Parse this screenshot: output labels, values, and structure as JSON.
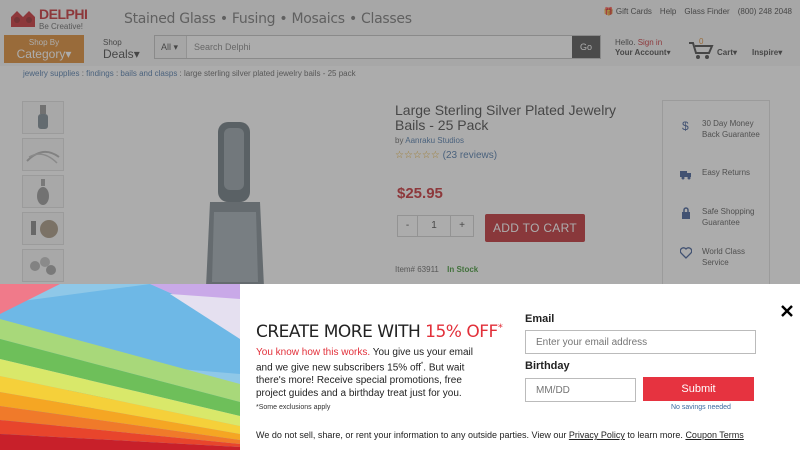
{
  "header": {
    "logo_name": "DELPHI",
    "logo_tagline": "Be Creative!",
    "site_tagline": "Stained Glass • Fusing • Mosaics • Classes",
    "top_links": [
      "Gift Cards",
      "Help",
      "Glass Finder",
      "(800) 248 2048"
    ],
    "shop_by_line1": "Shop By",
    "shop_by_line2": "Category",
    "shop_deals_line1": "Shop",
    "shop_deals_line2": "Deals",
    "search_scope": "All",
    "search_placeholder": "Search Delphi",
    "search_button": "Go",
    "hello": "Hello.",
    "sign_in": "Sign in",
    "your_account": "Your Account",
    "cart_count": "0",
    "cart_label": "Cart",
    "inspire_label": "Inspire"
  },
  "breadcrumb": {
    "items": [
      "jewelry supplies",
      "findings",
      "bails and clasps"
    ],
    "current": "large sterling silver plated jewelry bails - 25 pack"
  },
  "product": {
    "title": "Large Sterling Silver Plated Jewelry Bails - 25 Pack",
    "by_prefix": "by",
    "brand": "Aanraku Studios",
    "stars": "☆☆☆☆☆",
    "reviews": "(23 reviews)",
    "price": "$25.95",
    "qty_minus": "-",
    "qty_value": "1",
    "qty_plus": "+",
    "add_to_cart": "ADD TO CART",
    "item_label": "Item# 63911",
    "stock": "In Stock"
  },
  "benefits": [
    {
      "icon": "dollar-icon",
      "text": "30 Day Money Back Guarantee"
    },
    {
      "icon": "truck-icon",
      "text": "Easy Returns"
    },
    {
      "icon": "lock-icon",
      "text": "Safe Shopping Guarantee"
    },
    {
      "icon": "heart-icon",
      "text": "World Class Service"
    }
  ],
  "popup": {
    "headline": "CREATE MORE WITH",
    "headline_pct": "15% OFF",
    "headline_mark": "*",
    "body_red": "You know how this works.",
    "body_rest": " You give us your email and we give new subscribers 15% off",
    "body_mark": "*",
    "body_rest2": ". But wait there's more! Receive special promotions, free project guides and a birthday treat just for you.",
    "exclusions": "*Some exclusions apply",
    "email_label": "Email",
    "email_placeholder": "Enter your email address",
    "birthday_label": "Birthday",
    "birthday_placeholder": "MM/DD",
    "submit": "Submit",
    "no_savings": "No savings needed",
    "disclaimer_pre": "We do not sell, share, or rent your information to any outside parties. View our",
    "privacy_link": "Privacy Policy",
    "disclaimer_mid": "to learn more.",
    "coupon_link": "Coupon Terms"
  },
  "colors": {
    "brand_red": "#c0161c",
    "accent_orange": "#d97d1a",
    "promo_red": "#e2303a",
    "in_stock_green": "#2b8a1f"
  }
}
